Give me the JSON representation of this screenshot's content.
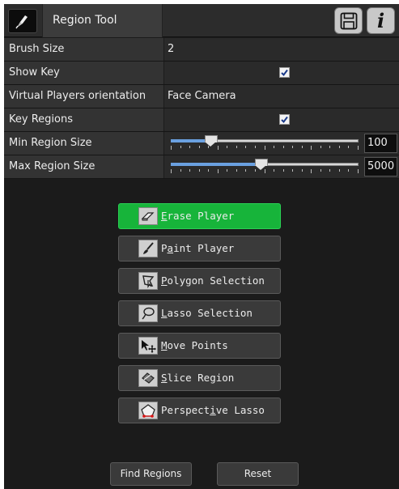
{
  "header": {
    "title": "Region Tool",
    "tool_icon": "region-pen-icon",
    "save_icon": "floppy-disk-icon",
    "info_glyph": "i"
  },
  "properties": {
    "brush_size": {
      "label": "Brush Size",
      "value": "2"
    },
    "show_key": {
      "label": "Show Key",
      "checked": true
    },
    "virtual_players_orientation": {
      "label": "Virtual Players orientation",
      "value": "Face Camera"
    },
    "key_regions": {
      "label": "Key Regions",
      "checked": true
    },
    "min_region_size": {
      "label": "Min Region Size",
      "value": "100",
      "slider_fraction": 0.21
    },
    "max_region_size": {
      "label": "Max Region Size",
      "value": "5000",
      "slider_fraction": 0.48
    }
  },
  "tools": [
    {
      "key": "E",
      "rest": "rase Player",
      "icon": "eraser-icon",
      "active": true
    },
    {
      "pre": "P",
      "key": "a",
      "rest": "int Player",
      "icon": "paintbrush-icon",
      "active": false
    },
    {
      "key": "P",
      "rest": "olygon Selection",
      "icon": "polygon-select-icon",
      "active": false
    },
    {
      "key": "L",
      "rest": "asso Selection",
      "icon": "lasso-icon",
      "active": false
    },
    {
      "key": "M",
      "rest": "ove Points",
      "icon": "move-points-icon",
      "active": false
    },
    {
      "key": "S",
      "rest": "lice Region",
      "icon": "slice-icon",
      "active": false
    },
    {
      "pre": "Perspect",
      "key": "i",
      "rest": "ve Lasso",
      "icon": "perspective-lasso-icon",
      "active": false
    }
  ],
  "footer": {
    "find_regions": "Find Regions",
    "reset": "Reset"
  },
  "colors": {
    "active_tool": "#17b43a",
    "panel_bg": "#1b1b1b",
    "slider_fill": "#6aa0e0"
  }
}
